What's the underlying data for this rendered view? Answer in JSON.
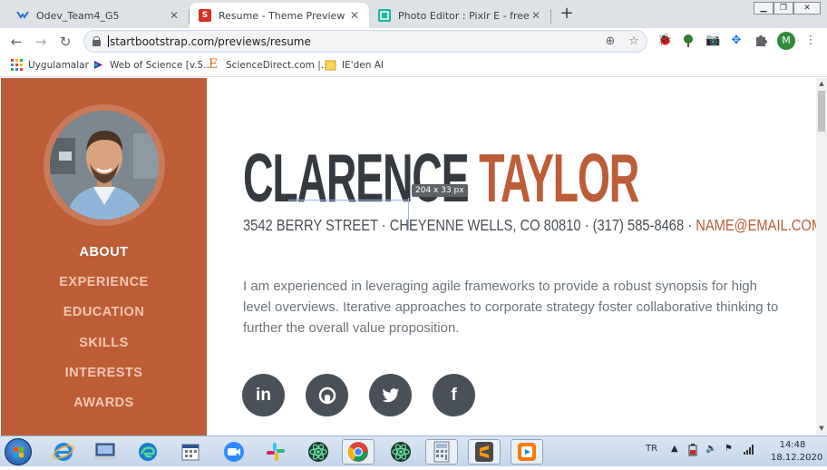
{
  "browser": {
    "tabs": [
      {
        "title": "Odev_Team4_G5",
        "active": false
      },
      {
        "title": "Resume - Theme Preview - Start",
        "active": true
      },
      {
        "title": "Photo Editor : Pixlr E - free image",
        "active": false
      }
    ],
    "new_tab_label": "+",
    "address": "startbootstrap.com/previews/resume",
    "profile_initial": "M",
    "bookmarks": [
      {
        "label": "Uygulamalar"
      },
      {
        "label": "Web of Science [v.5...."
      },
      {
        "label": "ScienceDirect.com |..."
      },
      {
        "label": "IE'den AI"
      }
    ]
  },
  "page": {
    "nav": [
      {
        "label": "ABOUT",
        "active": true
      },
      {
        "label": "EXPERIENCE",
        "active": false
      },
      {
        "label": "EDUCATION",
        "active": false
      },
      {
        "label": "SKILLS",
        "active": false
      },
      {
        "label": "INTERESTS",
        "active": false
      },
      {
        "label": "AWARDS",
        "active": false
      }
    ],
    "first_name": "CLARENCE",
    "last_name": "TAYLOR",
    "measure_badge": "204 x 33 px",
    "address_line": "3542 BERRY STREET · CHEYENNE WELLS, CO 80810 · (317) 585-8468 · ",
    "email": "NAME@EMAIL.COM",
    "about": "I am experienced in leveraging agile frameworks to provide a robust synopsis for high level overviews. Iterative approaches to corporate strategy foster collaborative thinking to further the overall value proposition.",
    "social": [
      {
        "icon": "linkedin-icon",
        "glyph": "in"
      },
      {
        "icon": "github-icon",
        "glyph": ""
      },
      {
        "icon": "twitter-icon",
        "glyph": ""
      },
      {
        "icon": "facebook-icon",
        "glyph": "f"
      }
    ],
    "colors": {
      "accent": "#bd5d38",
      "dark": "#343a40",
      "text": "#6c757d"
    }
  },
  "taskbar": {
    "language": "TR",
    "time": "14:48",
    "date": "18.12.2020"
  }
}
